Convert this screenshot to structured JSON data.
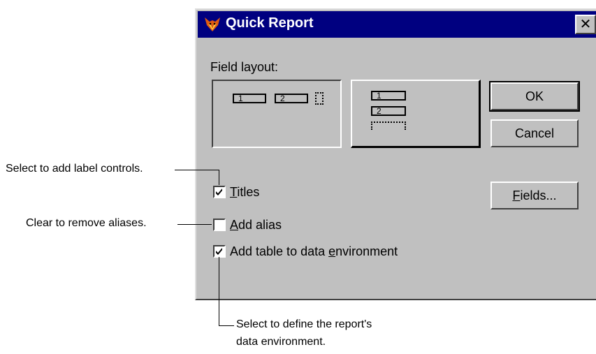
{
  "dialog": {
    "title": "Quick Report",
    "close_label": "✕",
    "field_layout_label": "Field layout:",
    "layout_options": [
      {
        "fields": [
          "1",
          "2"
        ]
      },
      {
        "fields": [
          "1",
          "2"
        ]
      }
    ],
    "buttons": {
      "ok": "OK",
      "cancel": "Cancel",
      "fields_prefix": "F",
      "fields_rest": "ields..."
    },
    "checkboxes": [
      {
        "accel": "T",
        "rest": "itles",
        "checked": true
      },
      {
        "pre": "",
        "accel": "A",
        "rest": "dd alias",
        "checked": false
      },
      {
        "pre": "Add table to data ",
        "accel": "e",
        "rest": "nvironment",
        "checked": true
      }
    ]
  },
  "callouts": {
    "titles": "Select to add label controls.",
    "alias": "Clear to remove aliases.",
    "env_line1": "Select to define the report's",
    "env_line2": "data environment."
  },
  "colors": {
    "face": "#c0c0c0",
    "titlebar": "#000080"
  }
}
